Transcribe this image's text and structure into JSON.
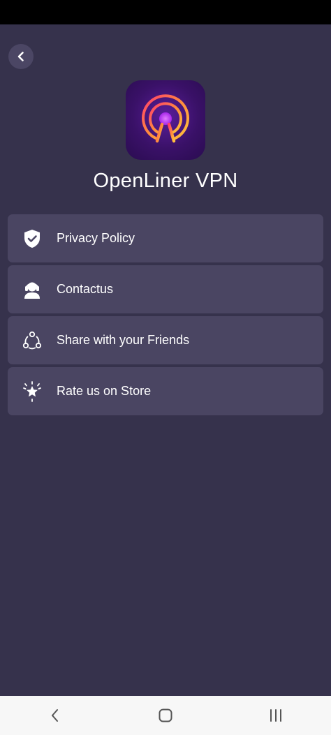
{
  "app": {
    "title": "OpenLiner VPN"
  },
  "menu": [
    {
      "label": "Privacy Policy",
      "icon": "shield-check-icon"
    },
    {
      "label": "Contactus",
      "icon": "headset-support-icon"
    },
    {
      "label": "Share with your Friends",
      "icon": "share-network-icon"
    },
    {
      "label": "Rate us on Store",
      "icon": "star-sparkle-icon"
    }
  ],
  "colors": {
    "background": "#36324c",
    "card": "#4a4562",
    "text": "#ffffff"
  },
  "navigation": {
    "back": "back-icon",
    "home": "home-icon",
    "recents": "recents-icon"
  }
}
